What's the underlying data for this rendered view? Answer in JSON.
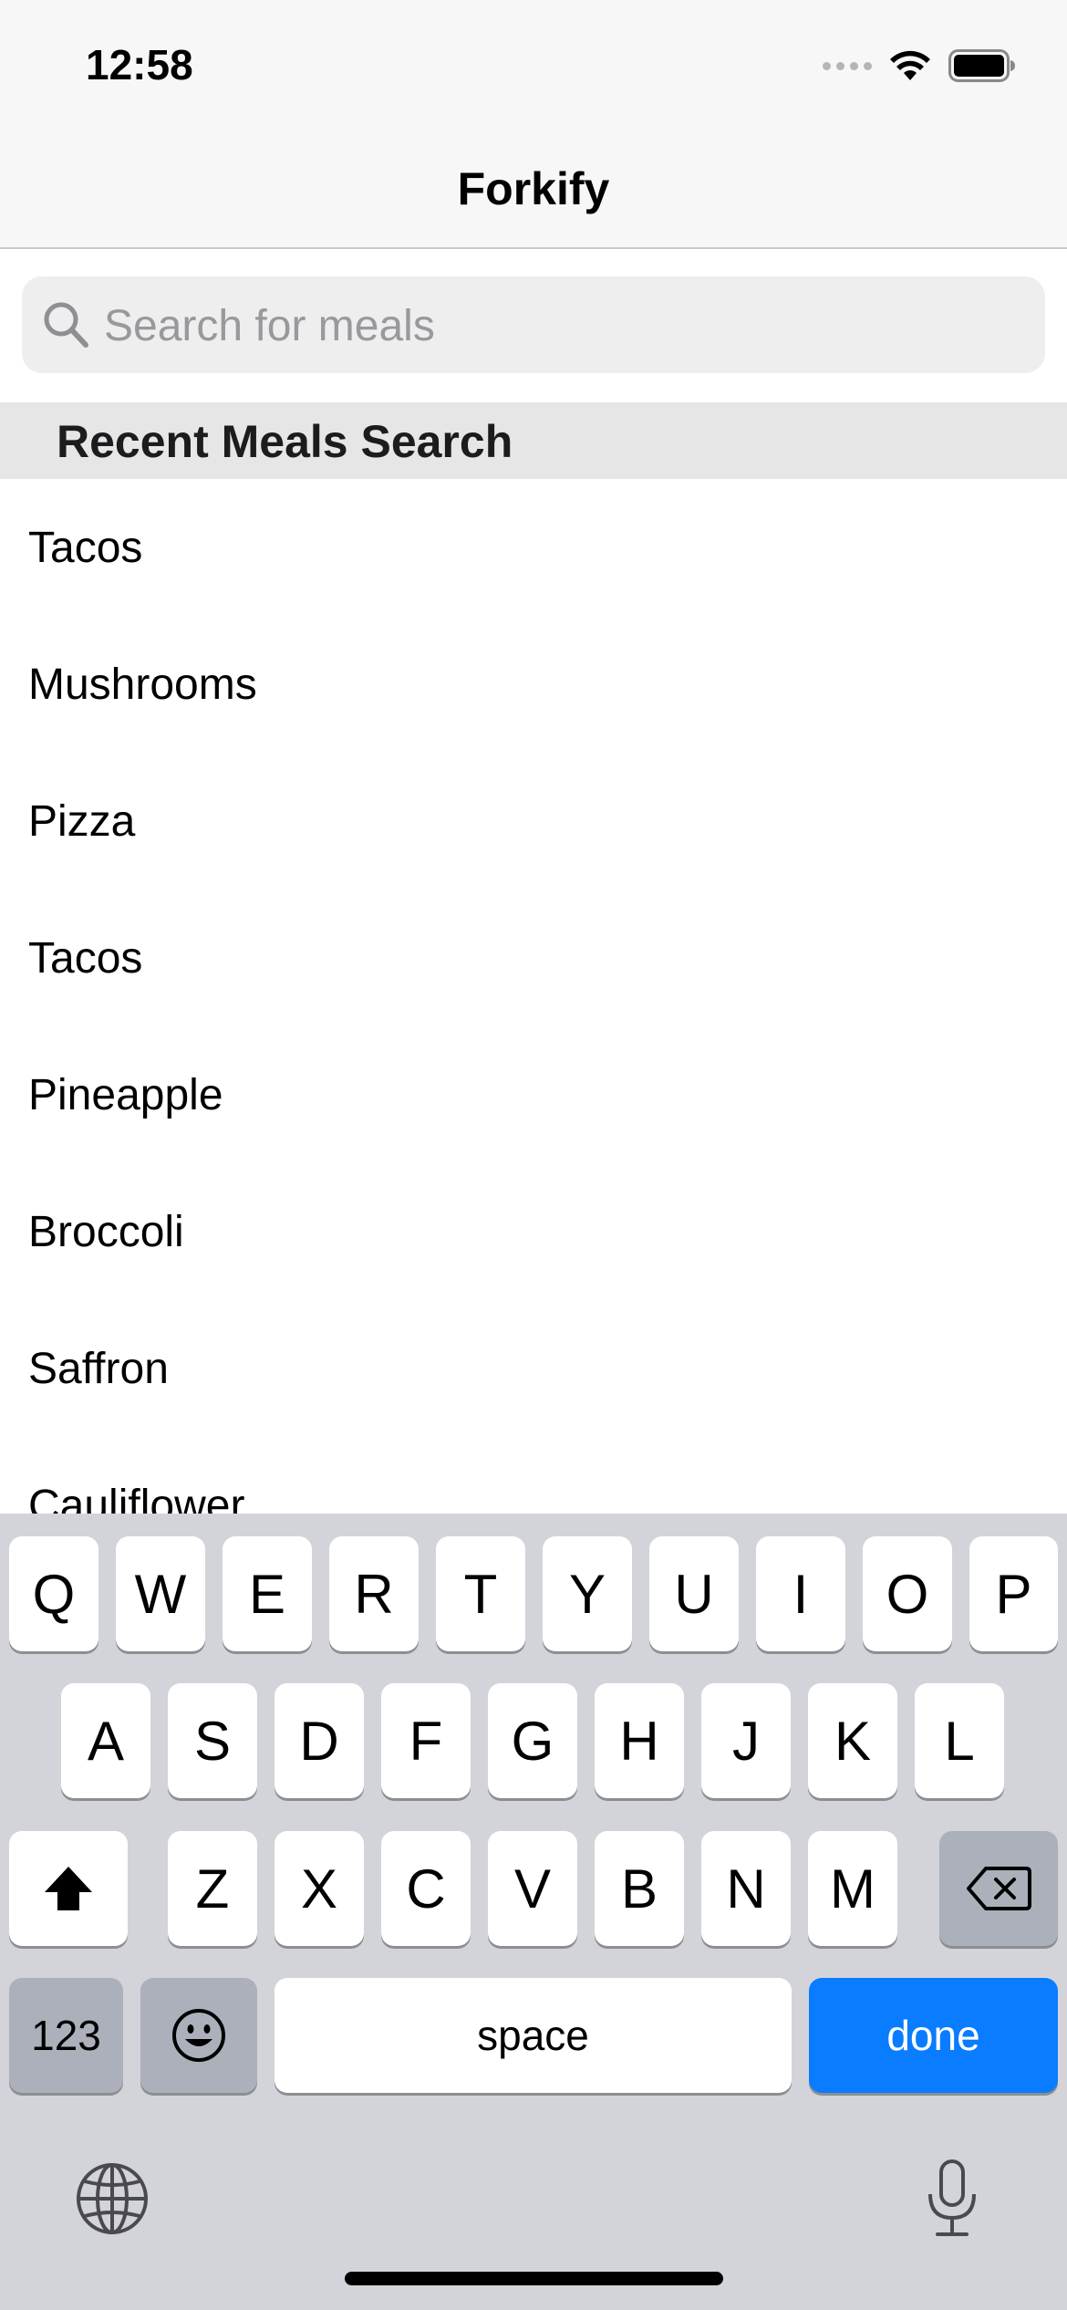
{
  "status": {
    "time": "12:58"
  },
  "nav": {
    "title": "Forkify"
  },
  "search": {
    "placeholder": "Search for meals",
    "value": ""
  },
  "section": {
    "title": "Recent Meals Search"
  },
  "recent_meals": [
    "Tacos",
    "Mushrooms",
    "Pizza",
    "Tacos",
    "Pineapple",
    "Broccoli",
    "Saffron",
    "Cauliflower"
  ],
  "keyboard": {
    "row1": [
      "Q",
      "W",
      "E",
      "R",
      "T",
      "Y",
      "U",
      "I",
      "O",
      "P"
    ],
    "row2": [
      "A",
      "S",
      "D",
      "F",
      "G",
      "H",
      "J",
      "K",
      "L"
    ],
    "row3": [
      "Z",
      "X",
      "C",
      "V",
      "B",
      "N",
      "M"
    ],
    "numbers_label": "123",
    "space_label": "space",
    "done_label": "done"
  },
  "colors": {
    "accent": "#0a7cff",
    "keyboard_bg": "#d2d4da",
    "section_bg": "#e6e6e7"
  },
  "icons": [
    "search-icon",
    "wifi-icon",
    "battery-icon",
    "shift-icon",
    "backspace-icon",
    "emoji-icon",
    "globe-icon",
    "microphone-icon"
  ]
}
